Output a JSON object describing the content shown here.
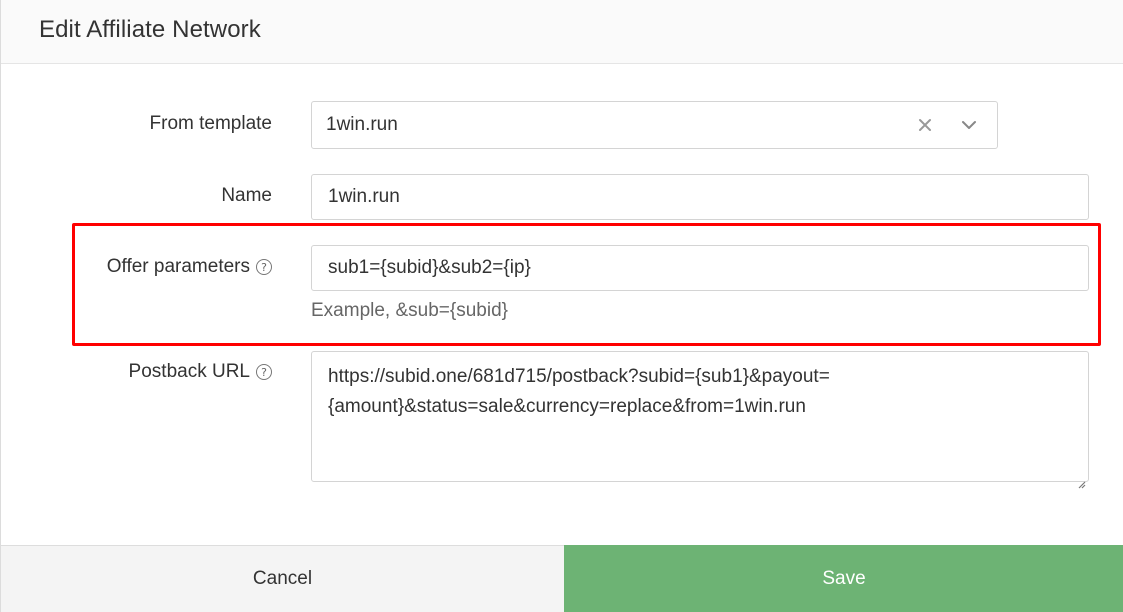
{
  "dialog": {
    "title": "Edit Affiliate Network"
  },
  "form": {
    "template": {
      "label": "From template",
      "value": "1win.run"
    },
    "name": {
      "label": "Name",
      "value": "1win.run"
    },
    "offer_parameters": {
      "label": "Offer parameters",
      "value": "sub1={subid}&sub2={ip}",
      "hint": "Example, &sub={subid}"
    },
    "postback_url": {
      "label": "Postback URL",
      "line1": "https://subid.one/681d715/postback?subid={sub1}&payout=",
      "line2": "{amount}&status=sale&currency=replace&from=1win.run"
    }
  },
  "help_glyph": "?",
  "footer": {
    "cancel_label": "Cancel",
    "save_label": "Save"
  },
  "colors": {
    "save_button": "#6db374",
    "highlight": "#ff0000"
  },
  "icons": {
    "clear": "close-icon",
    "chevron": "chevron-down-icon",
    "help": "help-circle-icon"
  }
}
